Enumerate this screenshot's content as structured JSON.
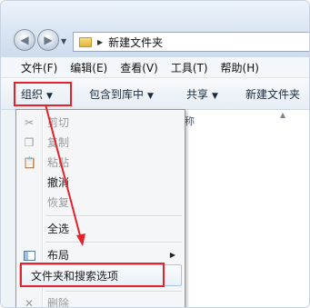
{
  "address": {
    "path": "新建文件夹"
  },
  "menubar": [
    {
      "label": "文件(F)"
    },
    {
      "label": "编辑(E)"
    },
    {
      "label": "查看(V)"
    },
    {
      "label": "工具(T)"
    },
    {
      "label": "帮助(H)"
    }
  ],
  "toolbar": {
    "organize": "组织",
    "include_library": "包含到库中",
    "share": "共享",
    "new_folder": "新建文件夹"
  },
  "file_list": {
    "name_header": "称"
  },
  "context_menu": {
    "items": [
      {
        "label": "剪切",
        "enabled": false,
        "icon": "scissors-icon"
      },
      {
        "label": "复制",
        "enabled": false,
        "icon": "copy-icon"
      },
      {
        "label": "粘贴",
        "enabled": false,
        "icon": "paste-icon"
      },
      {
        "label": "撤消",
        "enabled": true
      },
      {
        "label": "恢复",
        "enabled": false
      },
      {
        "label": "全选",
        "enabled": true
      },
      {
        "label": "布局",
        "enabled": true,
        "icon": "layout-icon",
        "submenu": true
      },
      {
        "label": "文件夹和搜索选项",
        "enabled": true,
        "hovered": true
      },
      {
        "label": "删除",
        "enabled": false,
        "icon": "delete-icon"
      }
    ]
  },
  "colors": {
    "highlight_red": "#e3222c",
    "disabled_text": "#9b9b9b"
  }
}
